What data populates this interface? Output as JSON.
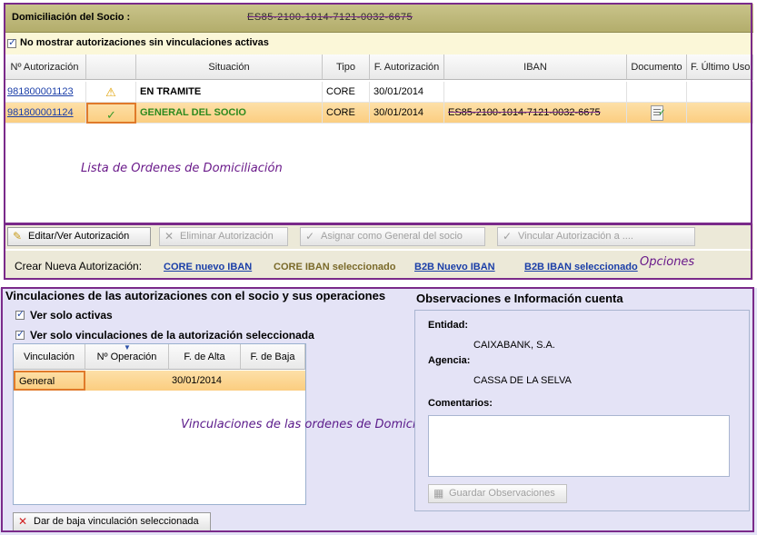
{
  "header": {
    "label": "Domiciliación del Socio  :",
    "iban_masked": "ES85-2100-1014-7121-0032-6675"
  },
  "filter": {
    "label": "No mostrar autorizaciones sin vinculaciones activas"
  },
  "grid": {
    "columns": [
      "Nº Autorización",
      "",
      "Situación",
      "Tipo",
      "F. Autorización",
      "IBAN",
      "Documento",
      "F. Último Uso"
    ],
    "rows": [
      {
        "num": "981800001123",
        "status_icon": "warning-icon",
        "situacion": "EN TRAMITE",
        "tipo": "CORE",
        "fecha": "30/01/2014",
        "iban": "",
        "doc": false
      },
      {
        "num": "981800001124",
        "status_icon": "check-icon",
        "situacion": "GENERAL DEL SOCIO",
        "tipo": "CORE",
        "fecha": "30/01/2014",
        "iban": "ES85-2100-1014-7121-0032-6675",
        "doc": true
      }
    ],
    "annotation": "Lista de Ordenes de Domiciliación"
  },
  "toolbar": {
    "edit": "Editar/Ver Autorización",
    "delete": "Eliminar Autorización",
    "assign": "Asignar como General del socio",
    "link": "Vincular Autorización a ...."
  },
  "create": {
    "label": "Crear Nueva Autorización:",
    "core_new": "CORE nuevo IBAN",
    "core_sel": "CORE IBAN seleccionado",
    "b2b_new": "B2B Nuevo IBAN",
    "b2b_sel": "B2B IBAN seleccionado",
    "annotation": "Opciones"
  },
  "vinculaciones": {
    "title": "Vinculaciones de las autorizaciones con el socio y sus operaciones",
    "opt_active": "Ver solo activas",
    "opt_selected": "Ver  solo vinculaciones de la autorización seleccionada",
    "columns": [
      "Vinculación",
      "Nº Operación",
      "F. de Alta",
      "F. de Baja"
    ],
    "rows": [
      {
        "vinculacion": "General",
        "operacion": "",
        "alta": "30/01/2014",
        "baja": ""
      }
    ],
    "unlink_button": "Dar de baja vinculación seleccionada",
    "annotation": "Vinculaciones de las ordenes de Domiciliación"
  },
  "observaciones": {
    "title": "Observaciones e Información cuenta",
    "entidad_label": "Entidad:",
    "entidad": "CAIXABANK, S.A.",
    "agencia_label": "Agencia:",
    "agencia": "CASSA DE LA SELVA",
    "comentarios_label": "Comentarios:",
    "save_button": "Guardar Observaciones"
  },
  "colors": {
    "highlight": "#7a2a8a",
    "selected_row": "#fbcd7f",
    "link": "#1a3ea8"
  }
}
